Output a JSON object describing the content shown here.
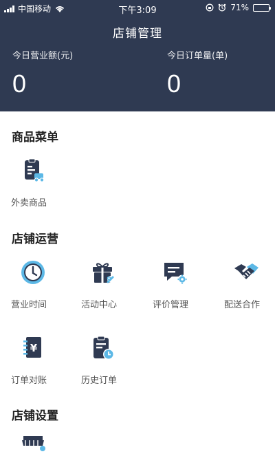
{
  "status_bar": {
    "carrier": "中国移动",
    "time": "下午3:09",
    "battery_text": "71%",
    "battery_level": 0.71,
    "icons": [
      "signal-icon",
      "wifi-icon",
      "lock-rotation-icon",
      "alarm-icon",
      "battery-icon"
    ]
  },
  "header": {
    "title": "店铺管理",
    "stats": [
      {
        "label": "今日营业额(元)",
        "value": "0"
      },
      {
        "label": "今日订单量(单)",
        "value": "0"
      }
    ]
  },
  "sections": [
    {
      "title": "商品菜单",
      "items": [
        {
          "label": "外卖商品",
          "icon": "takeout-goods-icon"
        }
      ]
    },
    {
      "title": "店铺运营",
      "items": [
        {
          "label": "营业时间",
          "icon": "clock-icon"
        },
        {
          "label": "活动中心",
          "icon": "gift-icon"
        },
        {
          "label": "评价管理",
          "icon": "review-icon"
        },
        {
          "label": "配送合作",
          "icon": "handshake-icon"
        },
        {
          "label": "订单对账",
          "icon": "ledger-icon"
        },
        {
          "label": "历史订单",
          "icon": "history-order-icon"
        }
      ]
    },
    {
      "title": "店铺设置",
      "items": [
        {
          "label": "",
          "icon": "store-icon"
        }
      ]
    }
  ],
  "colors": {
    "header_bg": "#2f3a52",
    "icon_dark": "#2f3a52",
    "icon_accent": "#5cb8e6"
  }
}
